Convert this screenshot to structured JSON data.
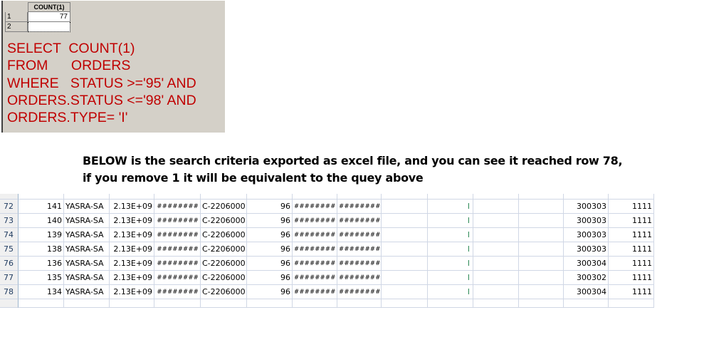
{
  "result_grid": {
    "column_header": "COUNT(1)",
    "rows": [
      {
        "num": "1",
        "value": "77"
      },
      {
        "num": "2",
        "value": ""
      }
    ]
  },
  "sql_query": [
    "SELECT  COUNT(1)",
    "FROM      ORDERS",
    "WHERE   STATUS >='95' AND",
    "ORDERS.STATUS <='98' AND",
    "ORDERS.TYPE= 'I'"
  ],
  "caption": {
    "line1": "BELOW is the search criteria exported as excel file, and you can see it reached row 78,",
    "line2": "if you remove 1 it will be equivalent to the quey above"
  },
  "sheet_rows": [
    {
      "num": "72",
      "id": "141",
      "name": "YASRA-SA",
      "num2": "2.13E+09",
      "d1": "########",
      "code": "C-2206000",
      "status": "96",
      "d2": "########",
      "d3": "########",
      "type": "I",
      "v1": "300303",
      "v2": "1111"
    },
    {
      "num": "73",
      "id": "140",
      "name": "YASRA-SA",
      "num2": "2.13E+09",
      "d1": "########",
      "code": "C-2206000",
      "status": "96",
      "d2": "########",
      "d3": "########",
      "type": "I",
      "v1": "300303",
      "v2": "1111"
    },
    {
      "num": "74",
      "id": "139",
      "name": "YASRA-SA",
      "num2": "2.13E+09",
      "d1": "########",
      "code": "C-2206000",
      "status": "96",
      "d2": "########",
      "d3": "########",
      "type": "I",
      "v1": "300303",
      "v2": "1111"
    },
    {
      "num": "75",
      "id": "138",
      "name": "YASRA-SA",
      "num2": "2.13E+09",
      "d1": "########",
      "code": "C-2206000",
      "status": "96",
      "d2": "########",
      "d3": "########",
      "type": "I",
      "v1": "300303",
      "v2": "1111"
    },
    {
      "num": "76",
      "id": "136",
      "name": "YASRA-SA",
      "num2": "2.13E+09",
      "d1": "########",
      "code": "C-2206000",
      "status": "96",
      "d2": "########",
      "d3": "########",
      "type": "I",
      "v1": "300304",
      "v2": "1111"
    },
    {
      "num": "77",
      "id": "135",
      "name": "YASRA-SA",
      "num2": "2.13E+09",
      "d1": "########",
      "code": "C-2206000",
      "status": "96",
      "d2": "########",
      "d3": "########",
      "type": "I",
      "v1": "300302",
      "v2": "1111"
    },
    {
      "num": "78",
      "id": "134",
      "name": "YASRA-SA",
      "num2": "2.13E+09",
      "d1": "########",
      "code": "C-2206000",
      "status": "96",
      "d2": "########",
      "d3": "########",
      "type": "I",
      "v1": "300304",
      "v2": "1111"
    }
  ],
  "colors": {
    "sql_text": "#c00000",
    "panel_bg": "#d4d0c8",
    "gridline": "#d0d7e5"
  }
}
